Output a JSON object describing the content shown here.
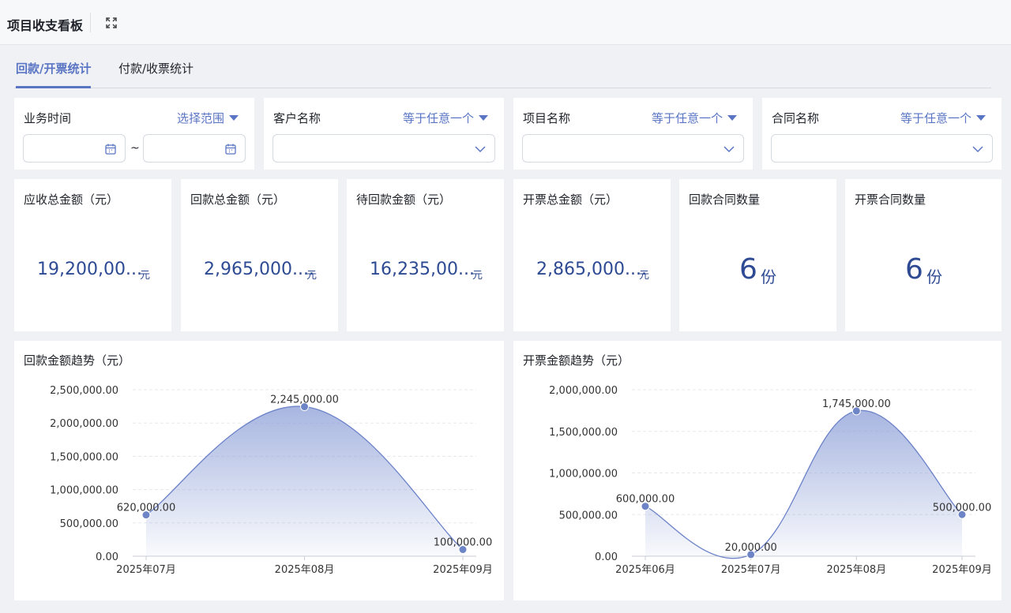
{
  "header": {
    "title": "项目收支看板",
    "expand_icon": "expand-icon"
  },
  "tabs": [
    {
      "label": "回款/开票统计",
      "active": true
    },
    {
      "label": "付款/收票统计",
      "active": false
    }
  ],
  "filters": {
    "business_time": {
      "label": "业务时间",
      "operator": "选择范围",
      "start_value": "",
      "end_value": "",
      "separator": "~"
    },
    "customer_name": {
      "label": "客户名称",
      "operator": "等于任意一个",
      "value": ""
    },
    "project_name": {
      "label": "项目名称",
      "operator": "等于任意一个",
      "value": ""
    },
    "contract_name": {
      "label": "合同名称",
      "operator": "等于任意一个",
      "value": ""
    }
  },
  "kpis": [
    {
      "label": "应收总金额（元）",
      "value": "19,200,00...",
      "unit": "元"
    },
    {
      "label": "回款总金额（元）",
      "value": "2,965,000....",
      "unit": "元"
    },
    {
      "label": "待回款金额（元）",
      "value": "16,235,00...",
      "unit": "元"
    },
    {
      "label": "开票总金额（元）",
      "value": "2,865,000....",
      "unit": "元"
    },
    {
      "label": "回款合同数量",
      "value": "6",
      "unit": "份"
    },
    {
      "label": "开票合同数量",
      "value": "6",
      "unit": "份"
    }
  ],
  "colors": {
    "accent": "#5a75c4",
    "value": "#2d4a93",
    "line": "#6b82c8"
  },
  "chart_data": [
    {
      "type": "area",
      "title": "回款金额趋势（元）",
      "categories": [
        "2025年07月",
        "2025年08月",
        "2025年09月"
      ],
      "values": [
        620000,
        2245000,
        100000
      ],
      "data_labels": [
        "620,000.00",
        "2,245,000.00",
        "100,000.00"
      ],
      "y_ticks": [
        "0.00",
        "500,000.00",
        "1,000,000.00",
        "1,500,000.00",
        "2,000,000.00",
        "2,500,000.00"
      ],
      "ylim": [
        0,
        2500000
      ],
      "grid": true
    },
    {
      "type": "area",
      "title": "开票金额趋势（元）",
      "categories": [
        "2025年06月",
        "2025年07月",
        "2025年08月",
        "2025年09月"
      ],
      "values": [
        600000,
        20000,
        1745000,
        500000
      ],
      "data_labels": [
        "600,000.00",
        "20,000.00",
        "1,745,000.00",
        "500,000.00"
      ],
      "y_ticks": [
        "0.00",
        "500,000.00",
        "1,000,000.00",
        "1,500,000.00",
        "2,000,000.00"
      ],
      "ylim": [
        0,
        2000000
      ],
      "grid": true
    }
  ]
}
